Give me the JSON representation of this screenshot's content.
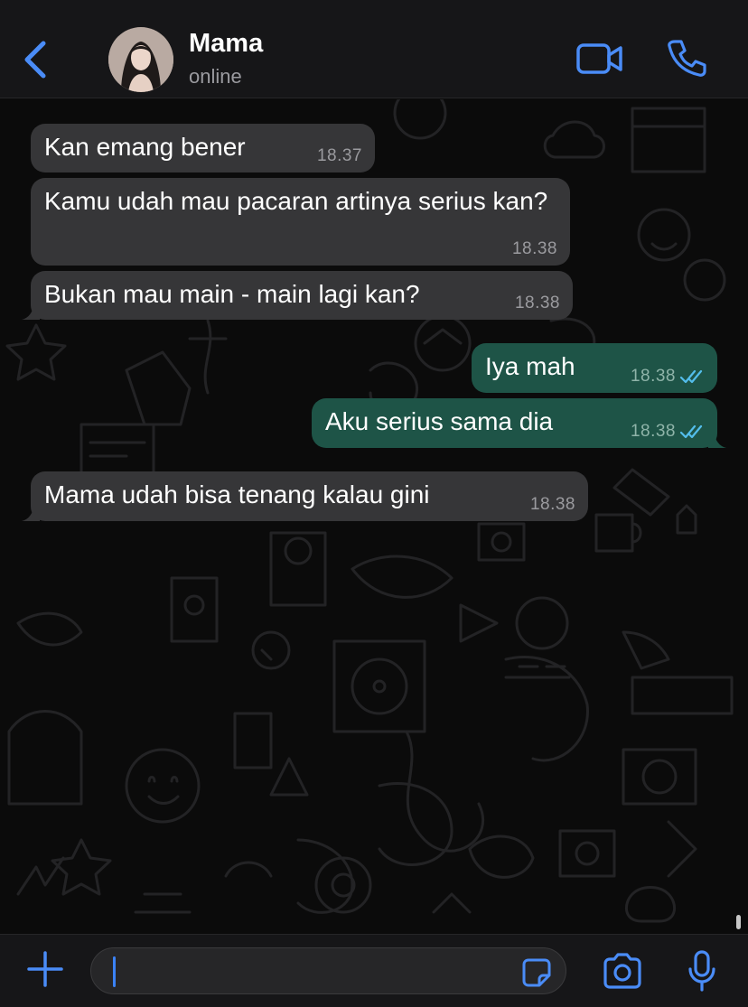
{
  "header": {
    "contact_name": "Mama",
    "status": "online",
    "back_icon": "chevron-left-icon",
    "video_icon": "video-camera-icon",
    "call_icon": "phone-icon"
  },
  "messages": [
    {
      "direction": "in",
      "text": "Kan emang bener",
      "time": "18.37"
    },
    {
      "direction": "in",
      "text": "Kamu udah mau pacaran artinya serius kan?",
      "time": "18.38"
    },
    {
      "direction": "in",
      "text": "Bukan mau main - main lagi kan?",
      "time": "18.38"
    },
    {
      "direction": "out",
      "text": "Iya mah",
      "time": "18.38",
      "status": "read"
    },
    {
      "direction": "out",
      "text": "Aku serius sama dia",
      "time": "18.38",
      "status": "read"
    },
    {
      "direction": "in",
      "text": "Mama udah bisa tenang kalau gini",
      "time": "18.38"
    }
  ],
  "composer": {
    "value": "",
    "icons": [
      "plus-icon",
      "sticker-icon",
      "camera-icon",
      "microphone-icon"
    ]
  },
  "colors": {
    "accent": "#3b82f6",
    "incoming_bubble": "#363638",
    "outgoing_bubble": "#1e5447",
    "read_ticks": "#53bdeb"
  }
}
